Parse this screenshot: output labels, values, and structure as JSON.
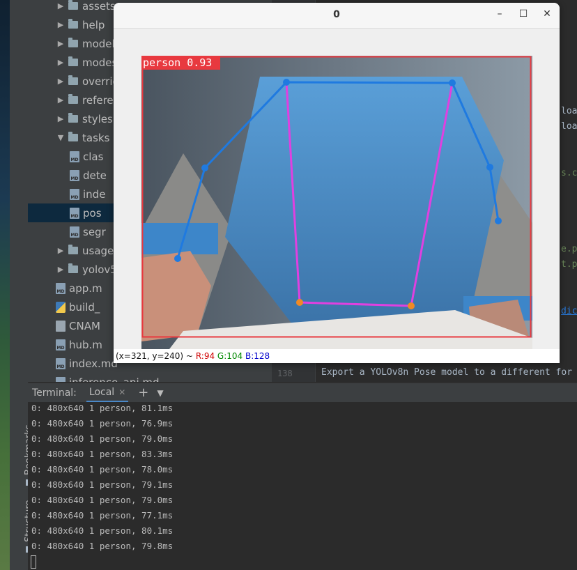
{
  "ide": {
    "sidebar_tabs": [
      "Bookmarks",
      "Structure"
    ],
    "tree": [
      {
        "label": "assets",
        "kind": "folder",
        "expanded": false,
        "depth": 1
      },
      {
        "label": "help",
        "kind": "folder",
        "expanded": false,
        "depth": 1
      },
      {
        "label": "model",
        "kind": "folder",
        "expanded": false,
        "depth": 1
      },
      {
        "label": "modes",
        "kind": "folder",
        "expanded": false,
        "depth": 1
      },
      {
        "label": "overric",
        "kind": "folder",
        "expanded": false,
        "depth": 1
      },
      {
        "label": "refere",
        "kind": "folder",
        "expanded": false,
        "depth": 1
      },
      {
        "label": "stylesh",
        "kind": "folder",
        "expanded": false,
        "depth": 1
      },
      {
        "label": "tasks",
        "kind": "folder",
        "expanded": true,
        "depth": 1
      },
      {
        "label": "clas",
        "kind": "md",
        "depth": 2
      },
      {
        "label": "dete",
        "kind": "md",
        "depth": 2
      },
      {
        "label": "inde",
        "kind": "md",
        "depth": 2
      },
      {
        "label": "pos",
        "kind": "md",
        "depth": 2,
        "selected": true
      },
      {
        "label": "segr",
        "kind": "md",
        "depth": 2
      },
      {
        "label": "usage",
        "kind": "folder",
        "expanded": false,
        "depth": 1
      },
      {
        "label": "yolov5",
        "kind": "folder",
        "expanded": false,
        "depth": 1
      },
      {
        "label": "app.m",
        "kind": "md",
        "depth": 1
      },
      {
        "label": "build_",
        "kind": "py",
        "depth": 1
      },
      {
        "label": "CNAM",
        "kind": "txt",
        "depth": 1
      },
      {
        "label": "hub.m",
        "kind": "md",
        "depth": 1
      },
      {
        "label": "index.md",
        "kind": "md",
        "depth": 1
      },
      {
        "label": "inference_api.md",
        "kind": "md",
        "depth": 1
      }
    ],
    "editor": {
      "line_number": "138",
      "fragments": [
        "loa",
        "loa",
        "s.c",
        "e.p",
        "t.p",
        "dic"
      ],
      "code_line": "Export a YOLOv8n Pose model to a different for"
    }
  },
  "terminal": {
    "label": "Terminal:",
    "tab": "Local",
    "lines": [
      "0: 480x640 1 person, 81.1ms",
      "0: 480x640 1 person, 76.9ms",
      "0: 480x640 1 person, 79.0ms",
      "0: 480x640 1 person, 83.3ms",
      "0: 480x640 1 person, 78.0ms",
      "0: 480x640 1 person, 79.1ms",
      "0: 480x640 1 person, 79.0ms",
      "0: 480x640 1 person, 77.1ms",
      "0: 480x640 1 person, 80.1ms",
      "0: 480x640 1 person, 79.8ms"
    ]
  },
  "image_window": {
    "title": "0",
    "detection_label": "person 0.93",
    "status": {
      "coords": "(x=321, y=240) ~",
      "r": "R:94",
      "g": "G:104",
      "b": "B:128"
    },
    "colors": {
      "box": "#e8393f",
      "label_bg": "#e8393f",
      "limb": "#1f7ae0",
      "torso": "#e040e0",
      "hip_point": "#f08a24"
    }
  }
}
